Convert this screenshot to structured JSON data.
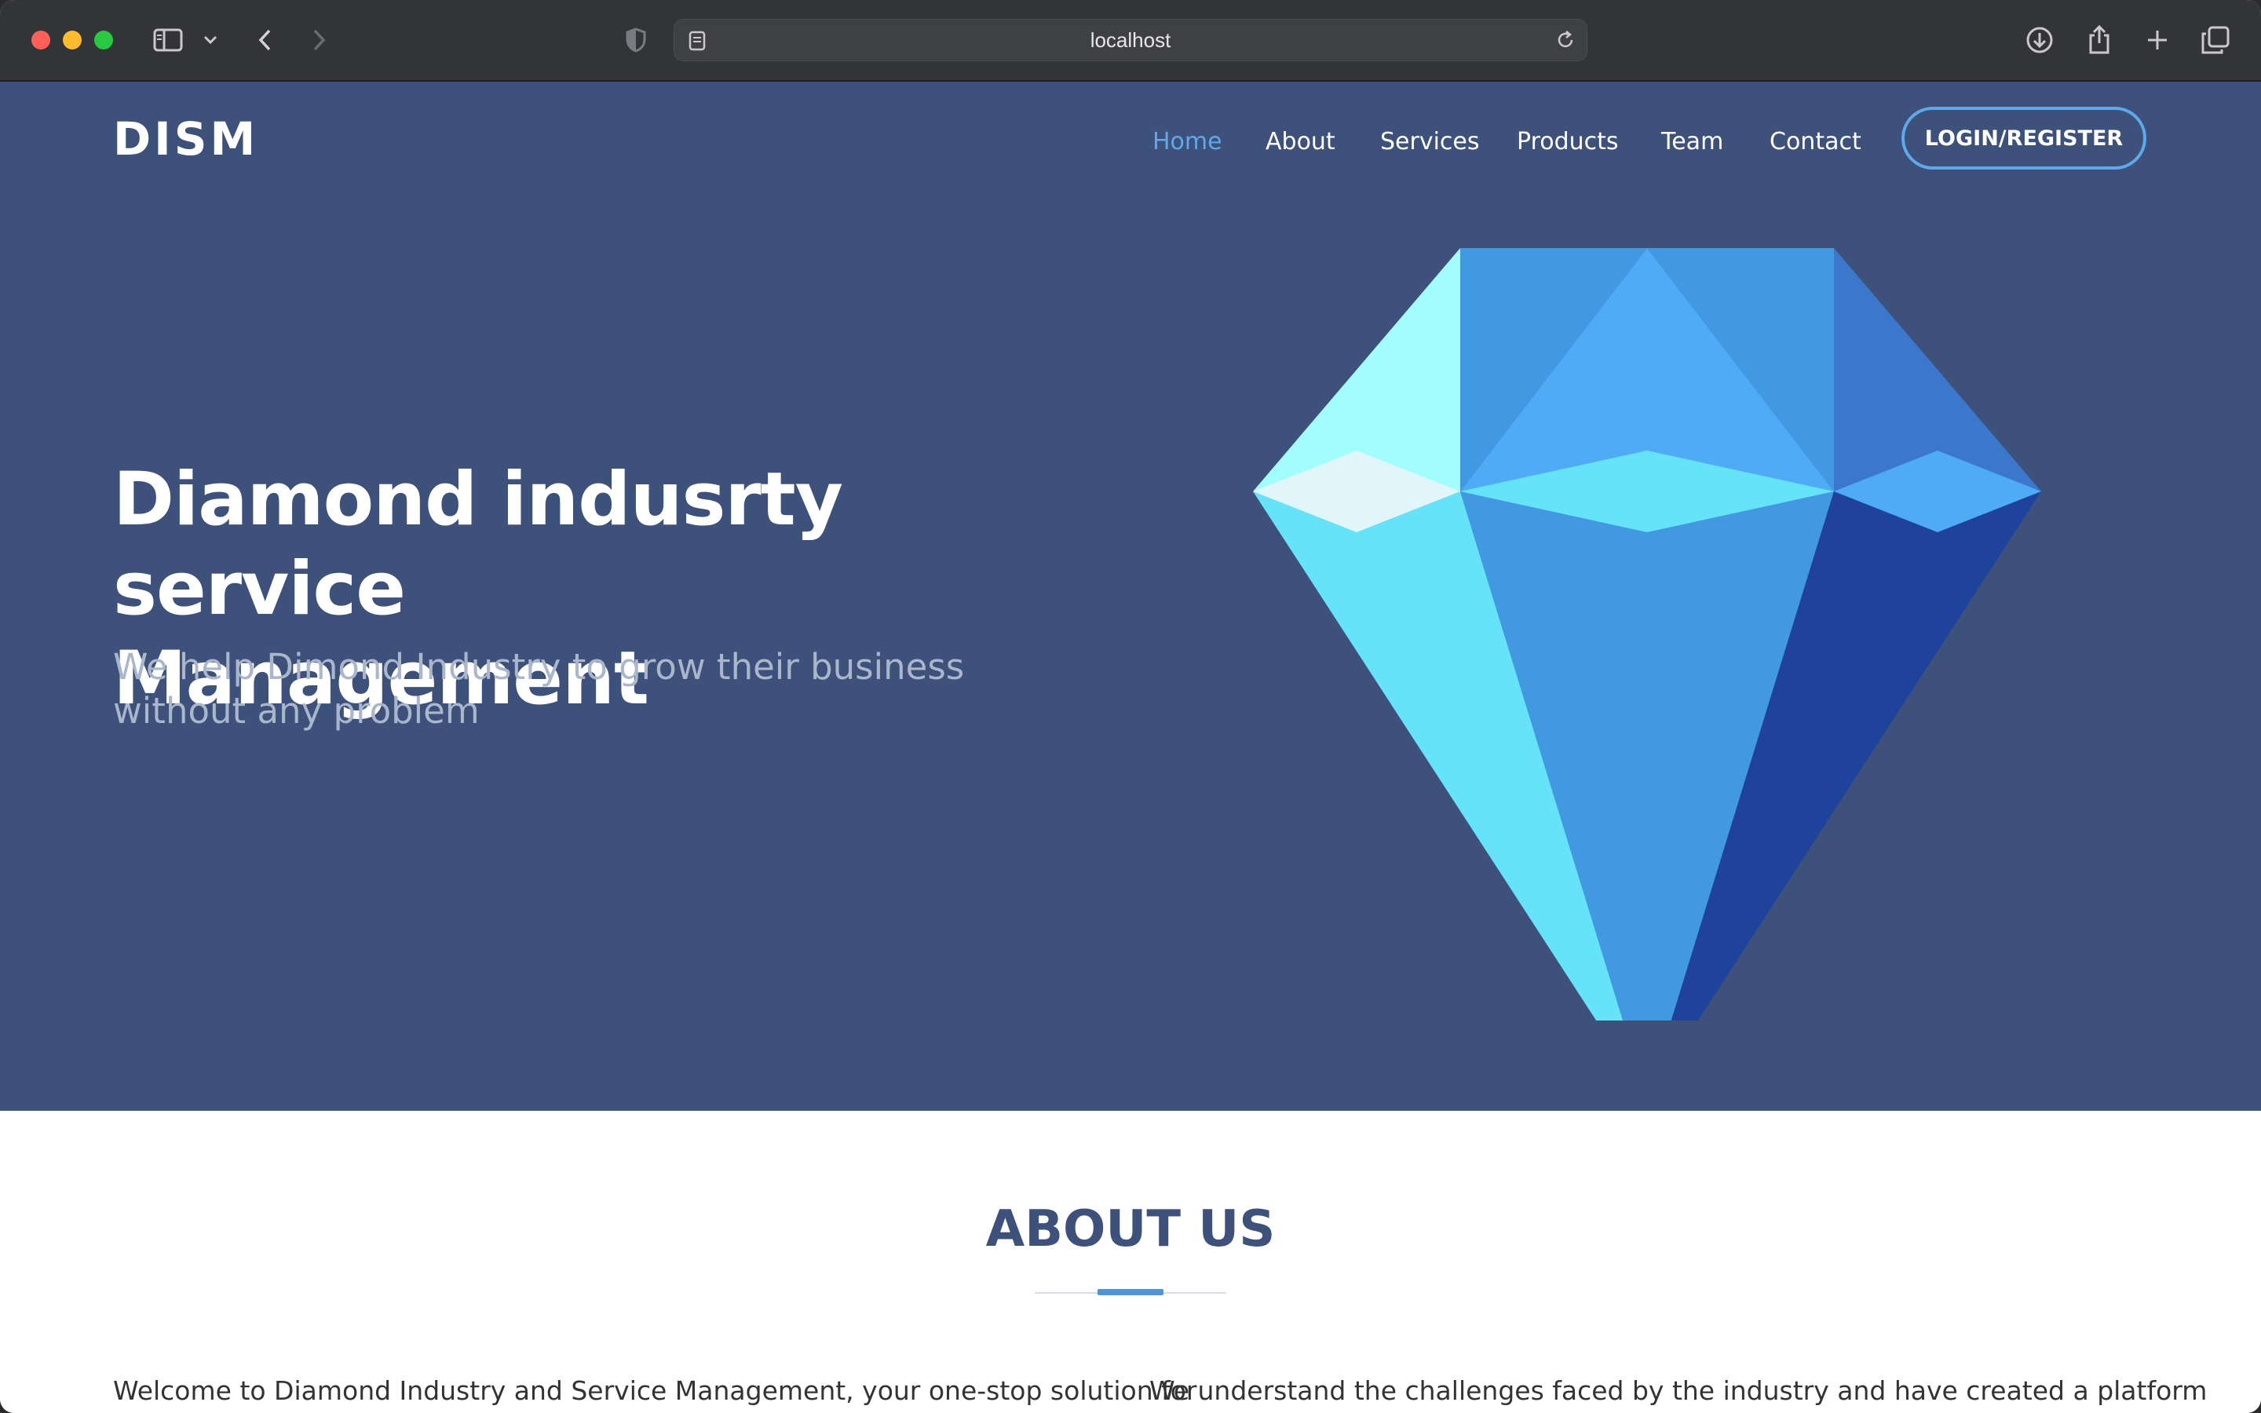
{
  "browser": {
    "url": "localhost",
    "icons": {
      "sidebar": "sidebar-icon",
      "sidebar_menu": "chevron-down-icon",
      "back": "chevron-left-icon",
      "forward": "chevron-right-icon",
      "privacy": "shield-icon",
      "page": "page-icon",
      "reload": "reload-icon",
      "download": "download-icon",
      "share": "share-icon",
      "new_tab": "plus-icon",
      "tabs": "tabs-overview-icon"
    }
  },
  "site": {
    "logo": "DISM",
    "nav": {
      "items": [
        {
          "label": "Home",
          "active": true
        },
        {
          "label": "About",
          "active": false
        },
        {
          "label": "Services",
          "active": false
        },
        {
          "label": "Products",
          "active": false
        },
        {
          "label": "Team",
          "active": false
        },
        {
          "label": "Contact",
          "active": false
        }
      ],
      "login_label": "LOGIN/REGISTER"
    },
    "hero": {
      "title_line1": "Diamond indusrty service",
      "title_line2": "Management",
      "subtitle": "We help Dimond Industry to grow their business without any problem",
      "image": "diamond-illustration"
    },
    "about": {
      "title": "ABOUT US",
      "left_text": "Welcome to Diamond Industry and Service Management, your one-stop solution for",
      "right_text": "We understand the challenges faced by the industry and have created a platform"
    }
  },
  "colors": {
    "hero_bg": "#3d517b",
    "accent": "#5fa8ea",
    "about_title": "#3d517b",
    "diamond_light": "#a2fdfd",
    "diamond_cyan": "#66e2f9",
    "diamond_blue": "#4299e1",
    "diamond_mid": "#4fabf6",
    "diamond_dark": "#1f439b"
  }
}
